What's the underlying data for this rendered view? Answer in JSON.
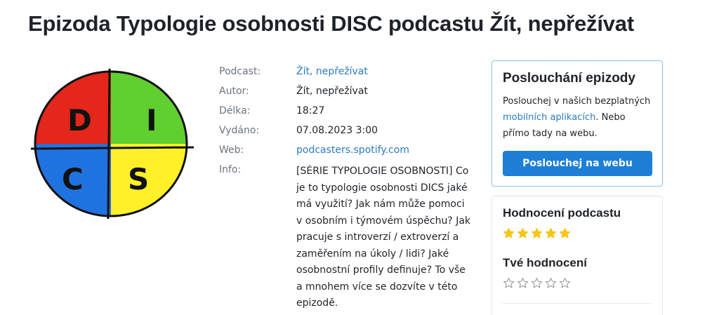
{
  "page": {
    "title": "Epizoda Typologie osobnosti DISC podcastu Žít, nepřežívat"
  },
  "cover": {
    "letters": [
      "D",
      "I",
      "C",
      "S"
    ]
  },
  "details": {
    "rows": [
      {
        "label": "Podcast:",
        "value": "Žít, nepřežívat"
      },
      {
        "label": "Autor:",
        "value": "Žít, nepřežívat"
      },
      {
        "label": "Délka:",
        "value": "18:27"
      },
      {
        "label": "Vydáno:",
        "value": "07.08.2023 3:00"
      },
      {
        "label": "Web:",
        "value": "podcasters.spotify.com"
      }
    ],
    "info_label": "Info:",
    "info_text": "[SÉRIE TYPOLOGIE OSOBNOSTI] Co je to typologie osobnosti DICS jaké má využití? Jak nám může pomoci v osobním i týmovém úspěchu? Jak pracuje s introverzí / extroverzí a zaměřením na úkoly / lidi? Jaké osobnostní profily definuje? To vše a mnohem více se dozvíte v této epizodě."
  },
  "listen": {
    "title": "Poslouchání epizody",
    "text_before": "Poslouchej v našich bezplatných ",
    "link": "mobilních aplikacích",
    "text_after": ". Nebo přímo tady na webu.",
    "button": "Poslouchej na webu"
  },
  "rating": {
    "podcast_title": "Hodnocení podcastu",
    "podcast_stars": 5,
    "user_title": "Tvé hodnocení",
    "user_stars": 0,
    "max_stars": 5
  },
  "colors": {
    "link": "#2b7bbf",
    "button": "#1d7fd6",
    "star_filled": "#f5c518",
    "quad_red": "#e5261a",
    "quad_green": "#5fd02f",
    "quad_blue": "#1f73e0",
    "quad_yellow": "#fff02a"
  }
}
